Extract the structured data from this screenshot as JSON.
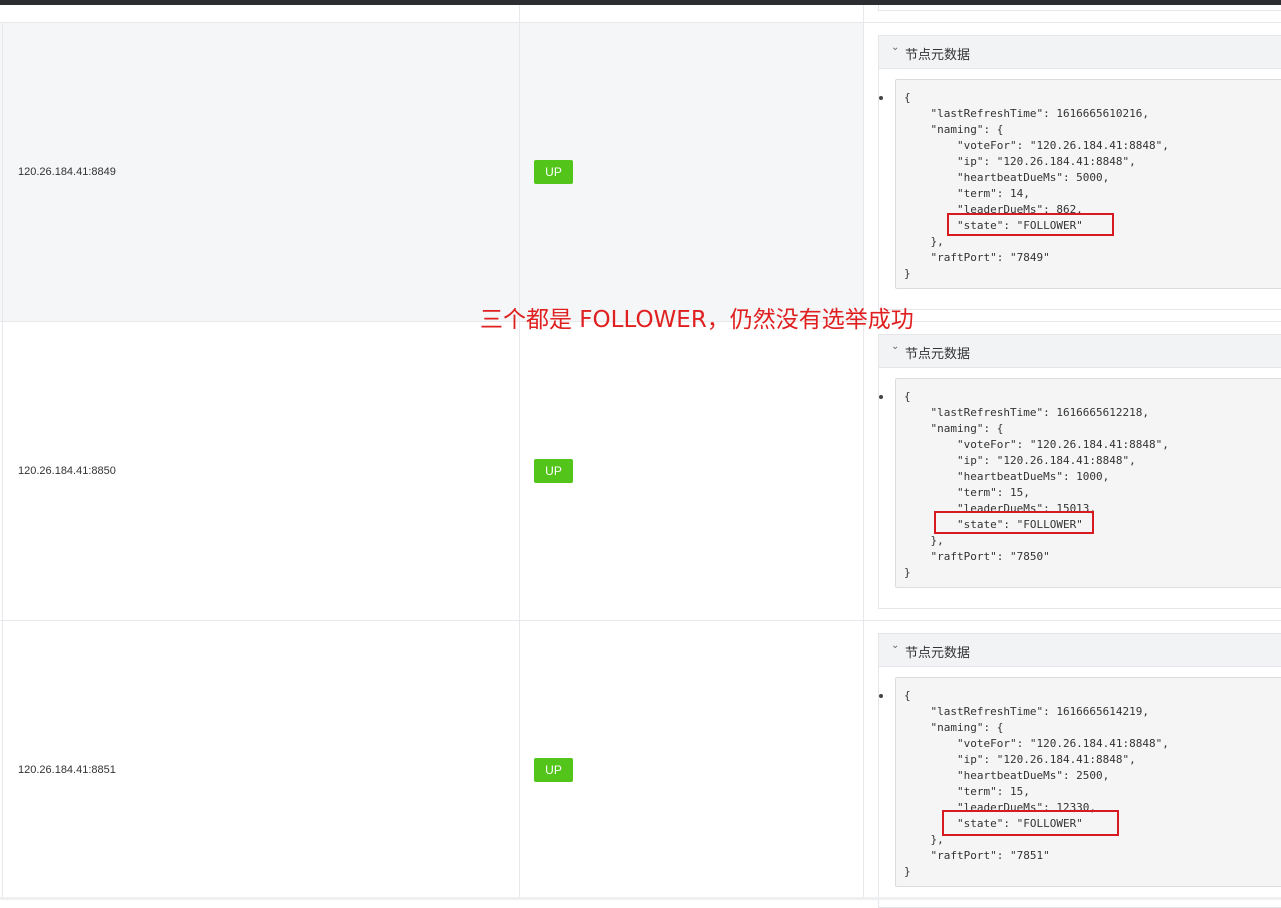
{
  "annotation": "三个都是 FOLLOWER，仍然没有选举成功",
  "panel_title": "节点元数据",
  "rows": [
    {
      "address": "120.26.184.41:8849",
      "status": "UP",
      "code": [
        "{",
        "    \"lastRefreshTime\": 1616665610216,",
        "    \"naming\": {",
        "        \"voteFor\": \"120.26.184.41:8848\",",
        "        \"ip\": \"120.26.184.41:8848\",",
        "        \"heartbeatDueMs\": 5000,",
        "        \"term\": 14,",
        "        \"leaderDueMs\": 862,",
        "        \"state\": \"FOLLOWER\"",
        "    },",
        "    \"raftPort\": \"7849\"",
        "}"
      ]
    },
    {
      "address": "120.26.184.41:8850",
      "status": "UP",
      "code": [
        "{",
        "    \"lastRefreshTime\": 1616665612218,",
        "    \"naming\": {",
        "        \"voteFor\": \"120.26.184.41:8848\",",
        "        \"ip\": \"120.26.184.41:8848\",",
        "        \"heartbeatDueMs\": 1000,",
        "        \"term\": 15,",
        "        \"leaderDueMs\": 15013,",
        "        \"state\": \"FOLLOWER\"",
        "    },",
        "    \"raftPort\": \"7850\"",
        "}"
      ]
    },
    {
      "address": "120.26.184.41:8851",
      "status": "UP",
      "code": [
        "{",
        "    \"lastRefreshTime\": 1616665614219,",
        "    \"naming\": {",
        "        \"voteFor\": \"120.26.184.41:8848\",",
        "        \"ip\": \"120.26.184.41:8848\",",
        "        \"heartbeatDueMs\": 2500,",
        "        \"term\": 15,",
        "        \"leaderDueMs\": 12330,",
        "        \"state\": \"FOLLOWER\"",
        "    },",
        "    \"raftPort\": \"7851\"",
        "}"
      ]
    }
  ]
}
